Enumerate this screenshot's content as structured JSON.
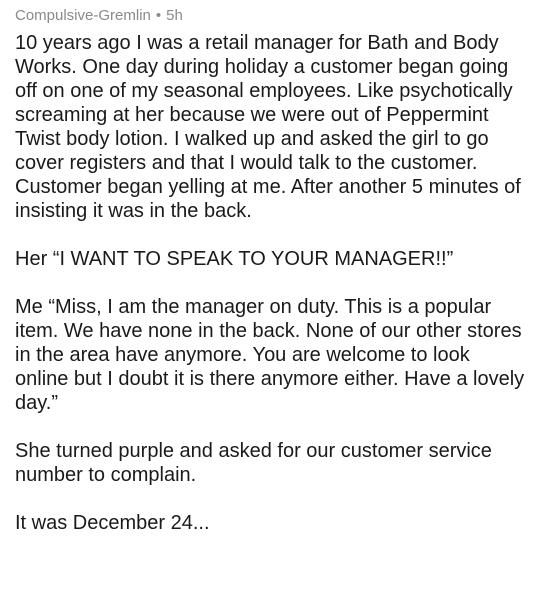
{
  "comment": {
    "author": "Compulsive-Gremlin",
    "separator": "•",
    "age": "5h",
    "paragraphs": [
      "10 years ago I was a retail manager for Bath and Body Works. One day during holiday a customer began going off on one of my seasonal employees. Like psychotically screaming at her because we were out of Peppermint Twist body lotion. I walked up and asked the girl to go cover registers and that I would talk to the customer. Customer began yelling at me. After another 5 minutes of insisting it was in the back.",
      "Her “I WANT TO SPEAK TO YOUR MANAGER!!”",
      "Me “Miss, I am the manager on duty. This is a popular item. We have none in the back. None of our other stores in the area have anymore. You are welcome to look online but I doubt it is there anymore either. Have a lovely day.”",
      "She turned purple and asked for our customer service number to complain.",
      "It was December 24..."
    ]
  }
}
